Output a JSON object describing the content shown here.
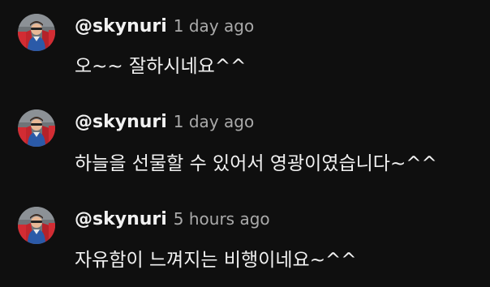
{
  "comments": [
    {
      "username": "@skynuri",
      "time": "1 day ago",
      "text": "오~~  잘하시네요^^",
      "avatar_icon": "user-avatar-photo"
    },
    {
      "username": "@skynuri",
      "time": "1 day ago",
      "text": "하늘을 선물할 수 있어서  영광이였습니다~^^",
      "avatar_icon": "user-avatar-photo"
    },
    {
      "username": "@skynuri",
      "time": "5 hours ago",
      "text": "자유함이 느껴지는 비행이네요~^^",
      "avatar_icon": "user-avatar-photo"
    }
  ],
  "colors": {
    "background": "#0f0f0f",
    "username": "#f1f1f1",
    "timestamp": "#aaaaaa",
    "text": "#f1f1f1"
  }
}
